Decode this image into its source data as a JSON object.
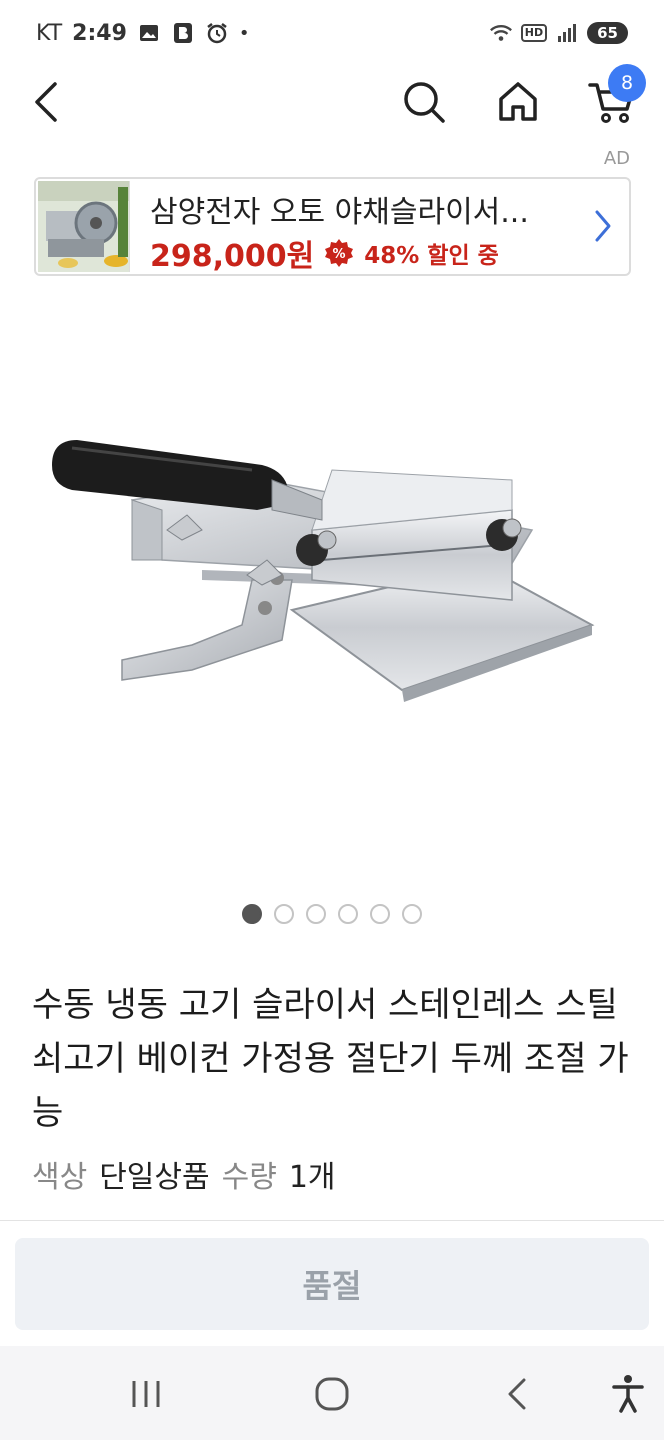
{
  "status_bar": {
    "carrier": "KT",
    "time": "2:49",
    "battery": "65",
    "hd": "HD"
  },
  "nav": {
    "cart_count": "8"
  },
  "ad": {
    "label": "AD",
    "title": "삼양전자 오토 야채슬라이서...",
    "price": "298,000원",
    "discount": "48% 할인 중",
    "accent_color": "#c8241a"
  },
  "product": {
    "title": "수동 냉동 고기 슬라이서 스테인레스 스틸 쇠고기 베이컨 가정용 절단기 두께 조절 가능",
    "image_count": 6,
    "active_image": 1,
    "option_color_label": "색상",
    "option_color_value": "단일상품",
    "option_qty_label": "수량",
    "option_qty_value": "1개"
  },
  "action": {
    "button_label": "품절"
  },
  "icons": [
    "back-arrow-icon",
    "search-icon",
    "home-icon",
    "cart-icon",
    "chevron-right-icon",
    "percent-icon",
    "recents-icon",
    "home-circle-icon",
    "system-back-icon",
    "accessibility-icon"
  ]
}
